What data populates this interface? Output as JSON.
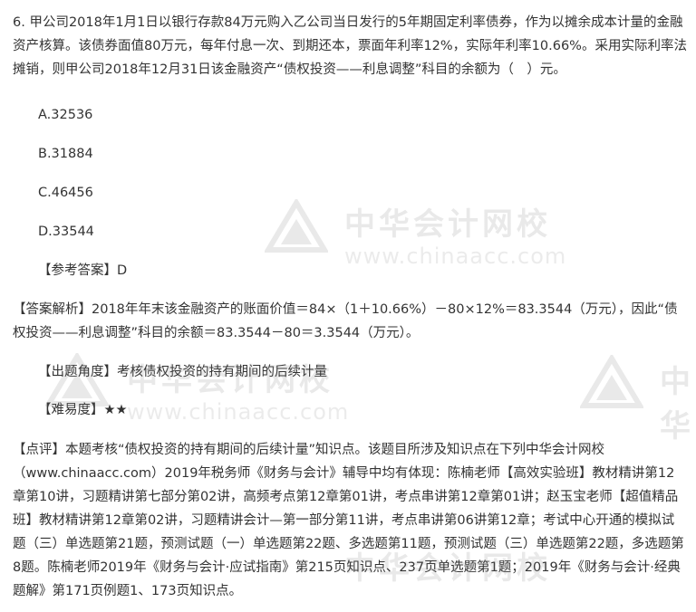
{
  "question": {
    "text": "6. 甲公司2018年1月1日以银行存款84万元购入乙公司当日发行的5年期固定利率债券，作为以摊余成本计量的金融资产核算。该债券面值80万元，每年付息一次、到期还本，票面年利率12%，实际年利率10.66%。采用实际利率法摊销，则甲公司2018年12月31日该金融资产“债权投资——利息调整”科目的余额为（　）元。"
  },
  "options": [
    "A.32536",
    "B.31884",
    "C.46456",
    "D.33544"
  ],
  "answer": "【参考答案】D",
  "analysis": "【答案解析】2018年年末该金融资产的账面价值＝84×（1＋10.66%）－80×12%＝83.3544（万元），因此“债权投资——利息调整”科目的余额＝83.3544－80＝3.3544（万元）。",
  "angle": "【出题角度】考核债权投资的持有期间的后续计量",
  "difficulty": "【难易度】★★",
  "review": "【点评】本题考核“债权投资的持有期间的后续计量”知识点。该题目所涉及知识点在下列中华会计网校（www.chinaacc.com）2019年税务师《财务与会计》辅导中均有体现：陈楠老师【高效实验班】教材精讲第12章第10讲，习题精讲第七部分第02讲，高频考点第12章第01讲，考点串讲第12章第01讲；赵玉宝老师【超值精品班】教材精讲第12章第02讲，习题精讲会计—第一部分第11讲，考点串讲第06讲第12章；考试中心开通的模拟试题（三）单选题第21题，预测试题（一）单选题第22题、多选题第11题，预测试题（三）单选题第22题，多选题第8题。陈楠老师2019年《财务与会计·应试指南》第215页知识点、237页单选题第1题；2019年《财务与会计·经典题解》第171页例题1、173页知识点。",
  "watermark": {
    "cn": "中华会计网校",
    "en": "www.chinaacc.com",
    "cn_partial": "中华"
  }
}
